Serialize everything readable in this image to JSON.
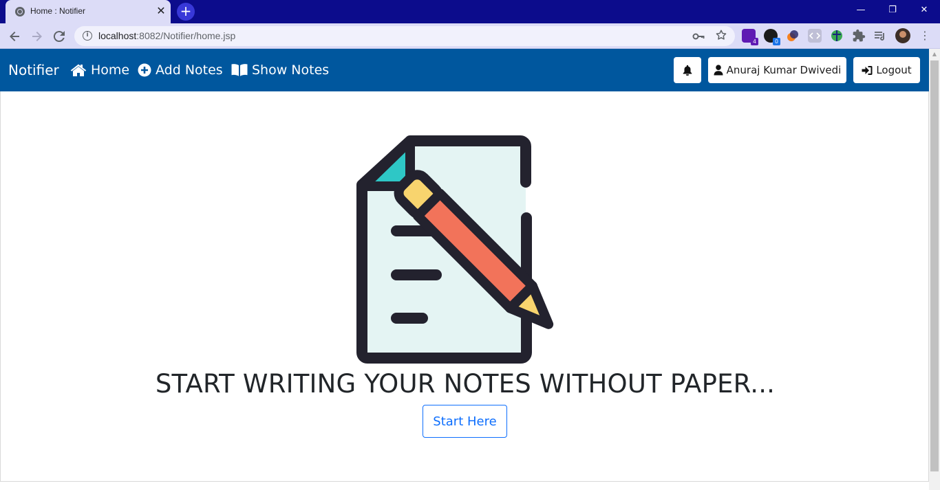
{
  "browser": {
    "tab_title": "Home : Notifier",
    "tab_close": "✕",
    "new_tab": "+",
    "url_host": "localhost",
    "url_path": ":8082/Notifier/home.jsp",
    "ext_badge_1": "4",
    "ext_badge_2": "0",
    "window_controls": {
      "minimize": "—",
      "restore": "❐",
      "close": "✕"
    }
  },
  "navbar": {
    "brand": "Notifier",
    "links": [
      {
        "label": "Home",
        "icon": "home-icon"
      },
      {
        "label": "Add Notes",
        "icon": "plus-circle-icon"
      },
      {
        "label": "Show Notes",
        "icon": "book-open-icon"
      }
    ],
    "user_name": "Anuraj Kumar Dwivedi",
    "logout_label": "Logout"
  },
  "hero": {
    "icon": "note-pencil-icon",
    "headline": "START WRITING YOUR NOTES WITHOUT PAPER...",
    "button_label": "Start Here"
  },
  "colors": {
    "navbar": "#00579e",
    "titlebar": "#0c0c8c",
    "accent_button": "#0d6efd",
    "headline": "#212529",
    "paper": "#e4f4f3",
    "pencil_body": "#f2735a",
    "pencil_tip": "#f8d46e",
    "fold": "#2ec7c6"
  }
}
